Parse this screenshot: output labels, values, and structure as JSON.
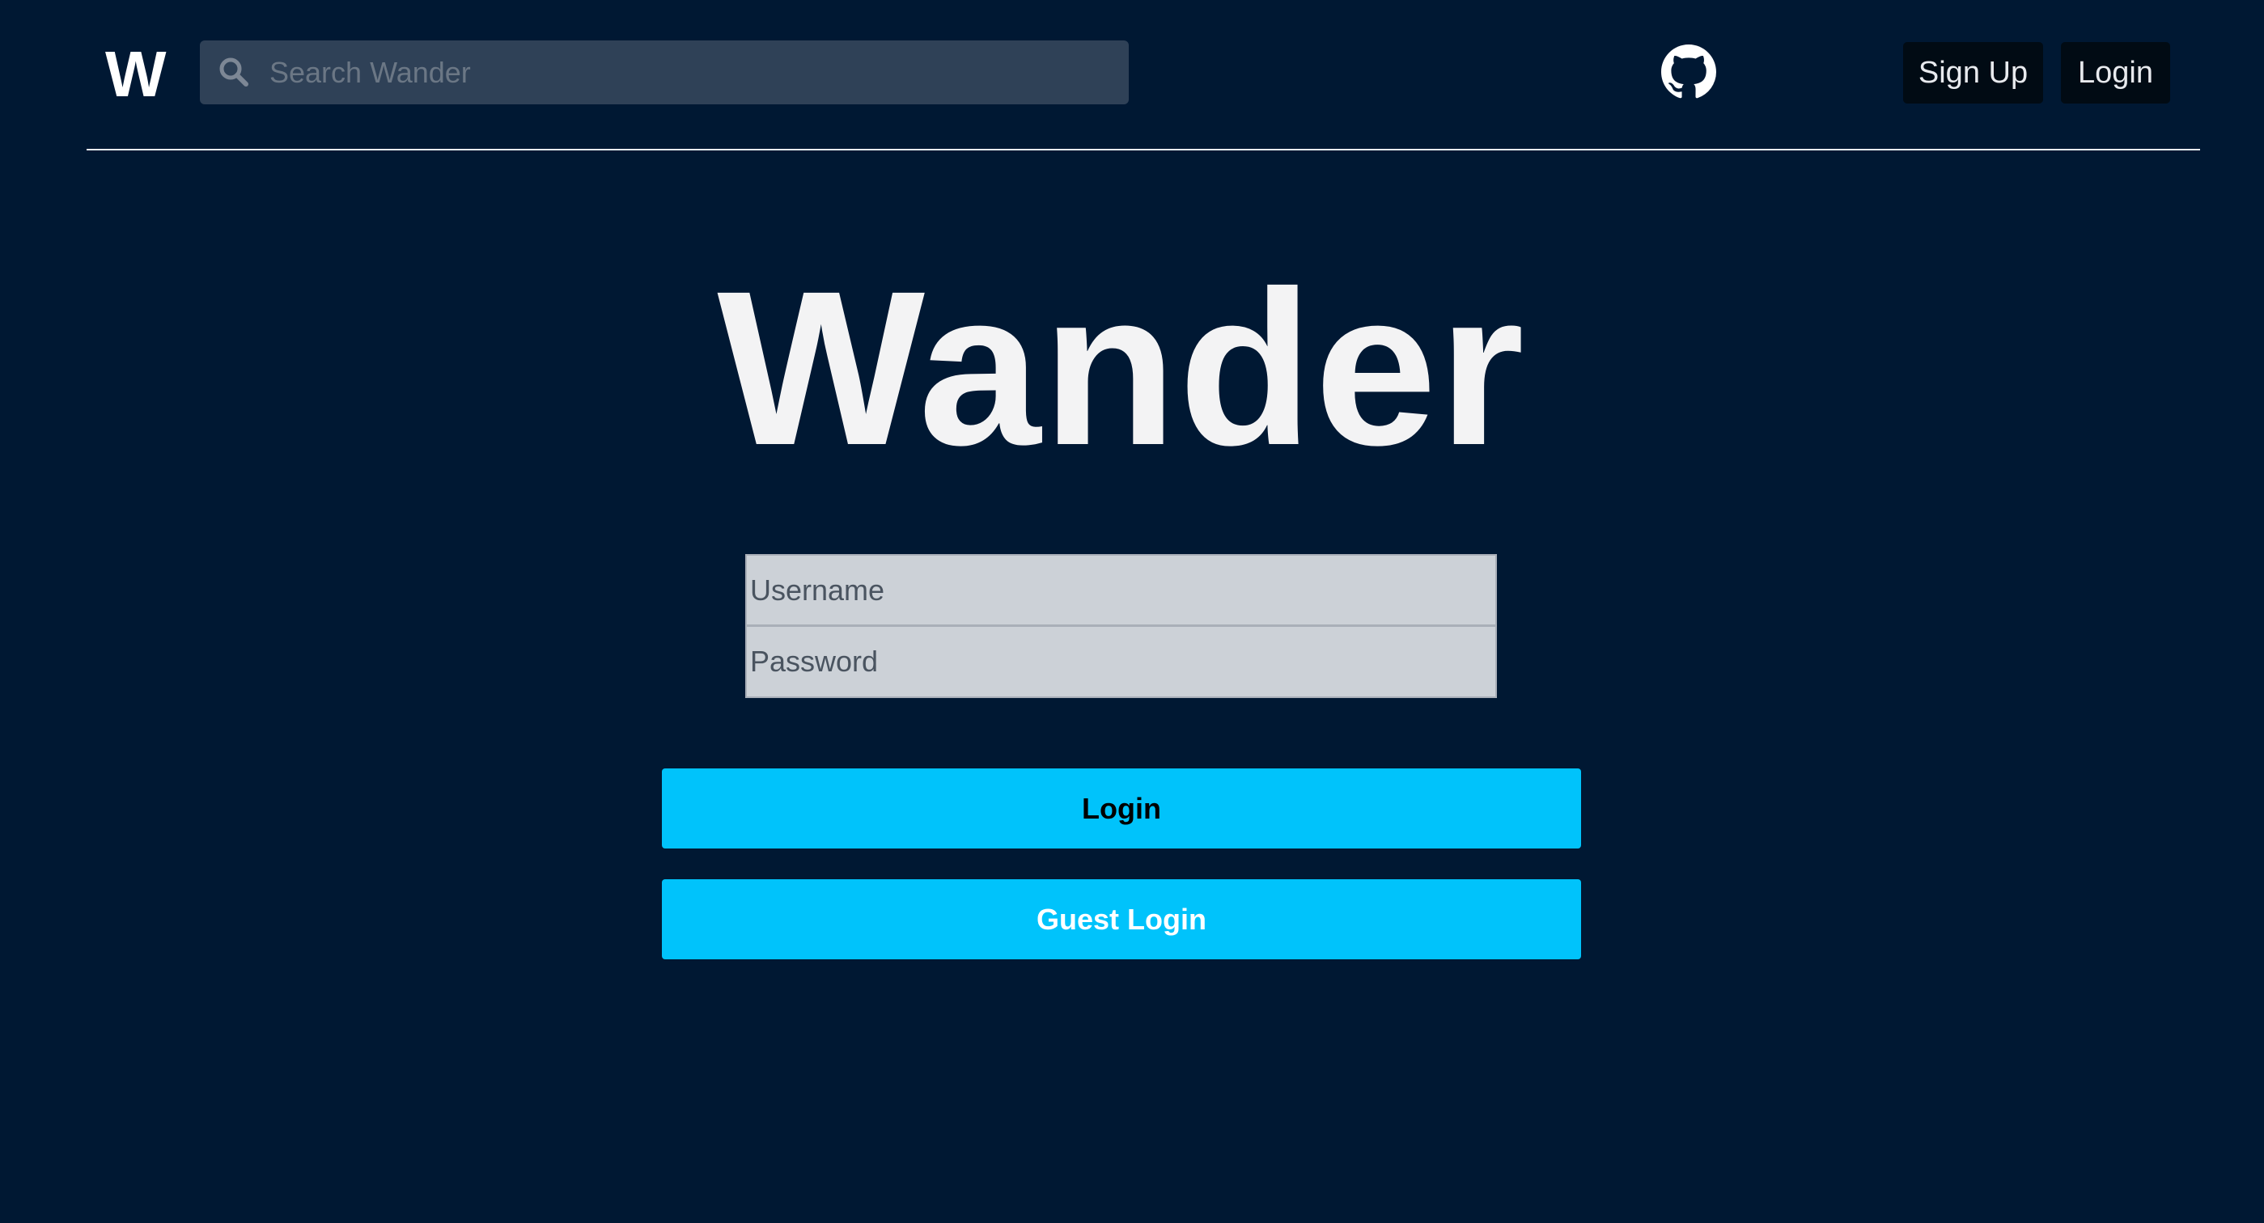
{
  "nav": {
    "logo": "W",
    "search_placeholder": "Search Wander",
    "signup_label": "Sign Up",
    "login_label": "Login",
    "github_icon": "github-icon",
    "search_icon": "search-icon"
  },
  "main": {
    "title": "Wander",
    "username_placeholder": "Username",
    "password_placeholder": "Password",
    "login_button": "Login",
    "guest_login_button": "Guest Login"
  },
  "colors": {
    "background": "#001833",
    "accent": "#00c3fb",
    "search_bg": "#2f4157",
    "nav_button_bg": "#010b14"
  }
}
